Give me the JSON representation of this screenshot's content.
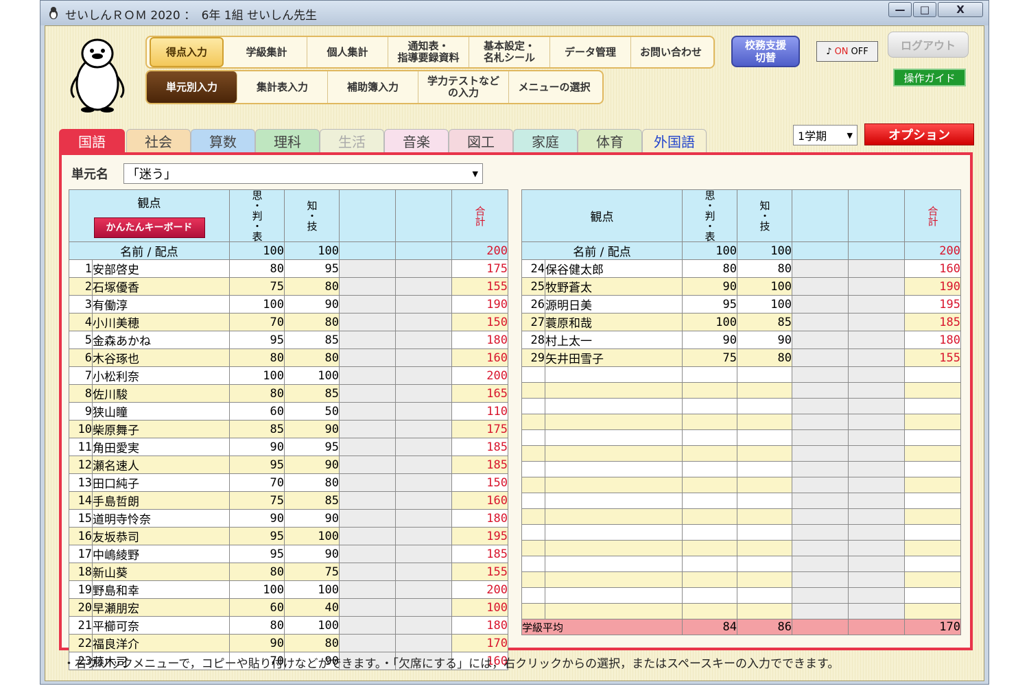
{
  "window": {
    "title": "せいしんＲＯＭ 2020 ：　6年 1組 せいしん先生",
    "min": "—",
    "max": "□",
    "close": "X"
  },
  "nav_top": [
    "得点入力",
    "学級集計",
    "個人集計",
    "通知表・\n指導要録資料",
    "基本設定・\n名札シール",
    "データ管理",
    "お問い合わせ"
  ],
  "nav_sub": [
    "単元別入力",
    "集計表入力",
    "補助簿入力",
    "学力テストなど\nの入力",
    "メニューの選択"
  ],
  "shien_button": "校務支援\n切替",
  "sound": {
    "on": "ON",
    "off": "OFF",
    "icon": "music-note-icon"
  },
  "logout": "ログアウト",
  "guide": "操作ガイド",
  "tabs": [
    "国語",
    "社会",
    "算数",
    "理科",
    "生活",
    "音楽",
    "図工",
    "家庭",
    "体育",
    "外国語"
  ],
  "semester": "1学期",
  "option": "オプション",
  "unit": {
    "label": "単元名",
    "value": "「迷う」"
  },
  "table": {
    "header_viewpoint": "観点",
    "keyboard_button": "かんたんキーボード",
    "col1": "思・判・表",
    "col2": "知・技",
    "total": "合計",
    "points_label": "名前 / 配点",
    "points": [
      "100",
      "100",
      "200"
    ],
    "average_label": "学級平均",
    "average": [
      "84",
      "86",
      "170"
    ]
  },
  "students_left": [
    {
      "no": "1",
      "name": "安部啓史",
      "a": "80",
      "b": "95",
      "t": "175"
    },
    {
      "no": "2",
      "name": "石塚優香",
      "a": "75",
      "b": "80",
      "t": "155"
    },
    {
      "no": "3",
      "name": "有働淳",
      "a": "100",
      "b": "90",
      "t": "190"
    },
    {
      "no": "4",
      "name": "小川美穂",
      "a": "70",
      "b": "80",
      "t": "150"
    },
    {
      "no": "5",
      "name": "金森あかね",
      "a": "95",
      "b": "85",
      "t": "180"
    },
    {
      "no": "6",
      "name": "木谷琢也",
      "a": "80",
      "b": "80",
      "t": "160"
    },
    {
      "no": "7",
      "name": "小松利奈",
      "a": "100",
      "b": "100",
      "t": "200"
    },
    {
      "no": "8",
      "name": "佐川駿",
      "a": "80",
      "b": "85",
      "t": "165"
    },
    {
      "no": "9",
      "name": "狭山瞳",
      "a": "60",
      "b": "50",
      "t": "110"
    },
    {
      "no": "10",
      "name": "柴原舞子",
      "a": "85",
      "b": "90",
      "t": "175"
    },
    {
      "no": "11",
      "name": "角田愛実",
      "a": "90",
      "b": "95",
      "t": "185"
    },
    {
      "no": "12",
      "name": "瀬名速人",
      "a": "95",
      "b": "90",
      "t": "185"
    },
    {
      "no": "13",
      "name": "田口純子",
      "a": "70",
      "b": "80",
      "t": "150"
    },
    {
      "no": "14",
      "name": "手島哲朗",
      "a": "75",
      "b": "85",
      "t": "160"
    },
    {
      "no": "15",
      "name": "道明寺怜奈",
      "a": "90",
      "b": "90",
      "t": "180"
    },
    {
      "no": "16",
      "name": "友坂恭司",
      "a": "95",
      "b": "100",
      "t": "195"
    },
    {
      "no": "17",
      "name": "中嶋綾野",
      "a": "95",
      "b": "90",
      "t": "185"
    },
    {
      "no": "18",
      "name": "新山葵",
      "a": "80",
      "b": "75",
      "t": "155"
    },
    {
      "no": "19",
      "name": "野島和幸",
      "a": "100",
      "b": "100",
      "t": "200"
    },
    {
      "no": "20",
      "name": "早瀬朋宏",
      "a": "60",
      "b": "40",
      "t": "100"
    },
    {
      "no": "21",
      "name": "平櫛可奈",
      "a": "80",
      "b": "100",
      "t": "180"
    },
    {
      "no": "22",
      "name": "福良洋介",
      "a": "90",
      "b": "80",
      "t": "170"
    },
    {
      "no": "23",
      "name": "藤木司",
      "a": "70",
      "b": "90",
      "t": "160"
    }
  ],
  "students_right": [
    {
      "no": "24",
      "name": "保谷健太郎",
      "a": "80",
      "b": "80",
      "t": "160"
    },
    {
      "no": "25",
      "name": "牧野蒼太",
      "a": "90",
      "b": "100",
      "t": "190"
    },
    {
      "no": "26",
      "name": "源明日美",
      "a": "95",
      "b": "100",
      "t": "195"
    },
    {
      "no": "27",
      "name": "蓑原和哉",
      "a": "100",
      "b": "85",
      "t": "185"
    },
    {
      "no": "28",
      "name": "村上太一",
      "a": "90",
      "b": "90",
      "t": "180"
    },
    {
      "no": "29",
      "name": "矢井田雪子",
      "a": "75",
      "b": "80",
      "t": "155"
    }
  ],
  "footer": "・右クリックメニューで，コピーや貼り付けなどができます。・「欠席にする」には，右クリックからの選択，またはスペースキーの入力でできます。",
  "colors": {
    "accent": "#e8344a",
    "header_bg": "#c8ecf8",
    "total_text": "#d8142c"
  }
}
